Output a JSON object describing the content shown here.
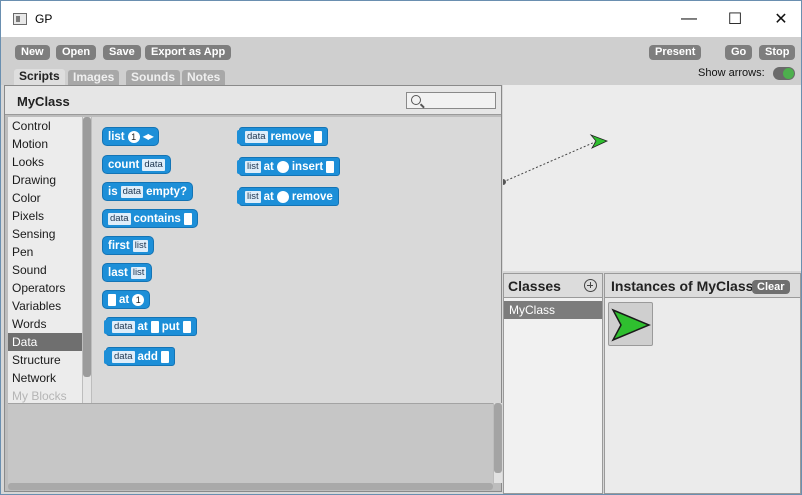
{
  "window": {
    "title": "GP"
  },
  "toolbar": {
    "new_label": "New",
    "open_label": "Open",
    "save_label": "Save",
    "export_label": "Export as App",
    "present_label": "Present",
    "go_label": "Go",
    "stop_label": "Stop",
    "show_arrows_label": "Show arrows:",
    "show_arrows_on": true
  },
  "tabs": [
    {
      "label": "Scripts",
      "active": true
    },
    {
      "label": "Images",
      "active": false
    },
    {
      "label": "Sounds",
      "active": false
    },
    {
      "label": "Notes",
      "active": false
    }
  ],
  "scripts": {
    "class_name": "MyClass",
    "categories": [
      "Control",
      "Motion",
      "Looks",
      "Drawing",
      "Color",
      "Pixels",
      "Sensing",
      "Pen",
      "Sound",
      "Operators",
      "Variables",
      "Words",
      "Data",
      "Structure",
      "Network",
      "My Blocks"
    ],
    "selected_category": "Data",
    "blocks": {
      "list_label": "list",
      "list_num": "1",
      "count_label": "count",
      "count_slot": "data",
      "is_label": "is",
      "is_slot": "data",
      "empty_label": "empty?",
      "contains_slot": "data",
      "contains_label": "contains",
      "first_label": "first",
      "first_slot": "list",
      "last_label": "last",
      "last_slot": "list",
      "at_label": "at",
      "at_num": "1",
      "put_slot": "data",
      "put_at_label": "at",
      "put_label": "put",
      "add_slot": "data",
      "add_label": "add",
      "remove_slot": "data",
      "remove_label": "remove",
      "insert_slot": "list",
      "insert_at_label": "at",
      "insert_label": "insert",
      "remove_at_slot": "list",
      "remove_at_label": "at",
      "remove_at_remove_label": "remove"
    }
  },
  "classes": {
    "title": "Classes",
    "items": [
      "MyClass"
    ]
  },
  "instances": {
    "title": "Instances of MyClass",
    "clear_label": "Clear"
  },
  "colors": {
    "block_blue": "#1d8fd8",
    "sprite_green": "#2fbf2f"
  }
}
